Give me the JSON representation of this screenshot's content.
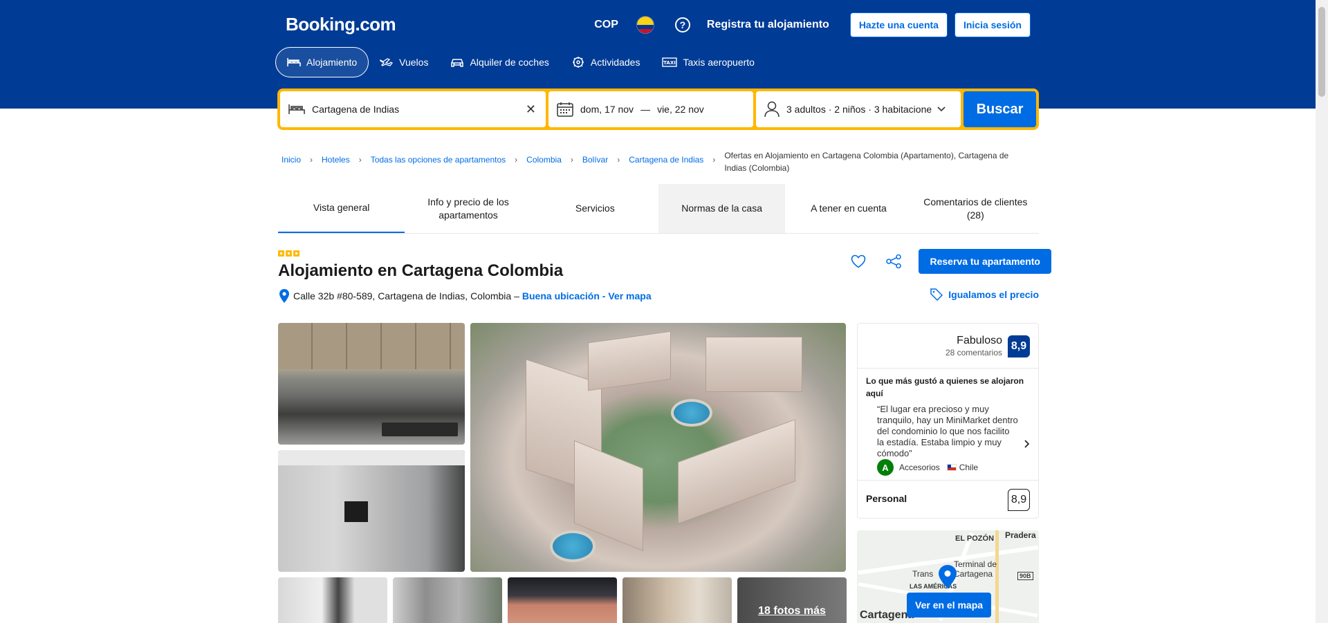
{
  "header": {
    "logo": "Booking.com",
    "currency": "COP",
    "register_property": "Registra tu alojamiento",
    "create_account": "Hazte una cuenta",
    "sign_in": "Inicia sesión",
    "help_glyph": "?"
  },
  "nav": {
    "items": [
      {
        "label": "Alojamiento",
        "icon": "bed-icon"
      },
      {
        "label": "Vuelos",
        "icon": "plane-icon"
      },
      {
        "label": "Alquiler de coches",
        "icon": "car-icon"
      },
      {
        "label": "Actividades",
        "icon": "attractions-icon"
      },
      {
        "label": "Taxis aeropuerto",
        "icon": "taxi-icon"
      }
    ]
  },
  "search": {
    "destination": "Cartagena de Indias",
    "clear_glyph": "✕",
    "date_from": "dom, 17 nov",
    "date_sep": "—",
    "date_to": "vie, 22 nov",
    "guests": "3 adultos · 2 niños · 3 habitacione",
    "button": "Buscar"
  },
  "breadcrumb": {
    "items": [
      "Inicio",
      "Hoteles",
      "Todas las opciones de apartamentos",
      "Colombia",
      "Bolívar",
      "Cartagena de Indias"
    ],
    "sep": "›",
    "current": "Ofertas en Alojamiento en Cartagena Colombia (Apartamento), Cartagena de Indias (Colombia)"
  },
  "tabs": [
    "Vista general",
    "Info y precio de los apartamentos",
    "Servicios",
    "Normas de la casa",
    "A tener en cuenta",
    "Comentarios de clientes (28)"
  ],
  "property": {
    "stars": 3,
    "title": "Alojamiento en Cartagena Colombia",
    "address": "Calle 32b #80-589, Cartagena de Indias, Colombia –",
    "location_link": "Buena ubicación - Ver mapa",
    "reserve_button": "Reserva tu apartamento",
    "price_match": "Igualamos el precio"
  },
  "photos": {
    "more_label": "18 fotos más"
  },
  "review": {
    "label": "Fabuloso",
    "count": "28 comentarios",
    "score": "8,9",
    "liked_heading": "Lo que más gustó a quienes se alojaron aquí",
    "quote": "“El lugar era precioso y muy tranquilo, hay un MiniMarket dentro del condominio lo que nos facilito la estadía. Estaba limpio y muy cómodo”",
    "reviewer_initial": "A",
    "reviewer_name": "Accesorios",
    "reviewer_country": "Chile",
    "staff_label": "Personal",
    "staff_score": "8,9"
  },
  "map": {
    "labels": [
      "EL POZÓN",
      "Pradera",
      "Terminal de",
      "Cartagena",
      "Trans",
      "LAS AMÉRICAS",
      "Cartagena",
      "90B"
    ],
    "button": "Ver en el mapa"
  },
  "colors": {
    "brand_blue": "#003b95",
    "action_blue": "#006ce4",
    "search_yellow": "#ffb700",
    "star_yellow": "#febb02",
    "green": "#008009"
  }
}
